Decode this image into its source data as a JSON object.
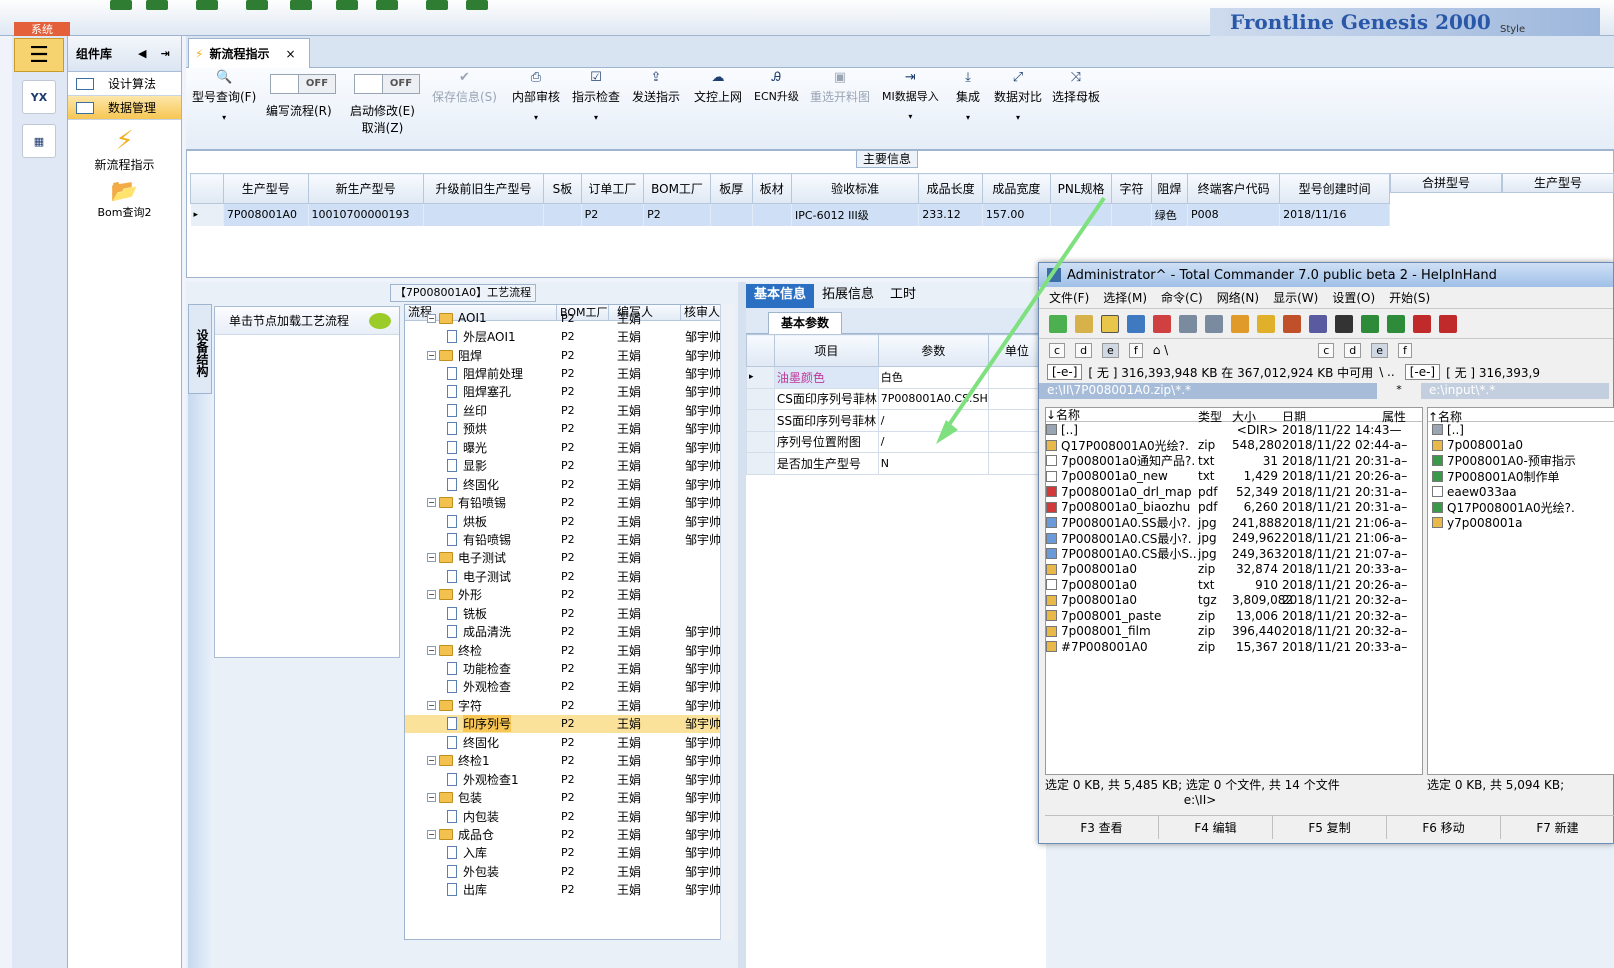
{
  "app": {
    "system_tab": "系统",
    "brand_text": "Frontline Genesis 2000",
    "style_label": "Style"
  },
  "sidebar": {
    "logo_label": "YX"
  },
  "components": {
    "header": "组件库",
    "items": [
      {
        "label": "设计算法"
      },
      {
        "label": "数据管理"
      }
    ],
    "big_items": [
      {
        "label": "新流程指示"
      },
      {
        "label": "Bom查询2"
      }
    ]
  },
  "tab": {
    "title": "新流程指示",
    "close": "×"
  },
  "ribbon": {
    "buttons": [
      {
        "label": "型号查询(F)",
        "icon": "🔍"
      },
      {
        "label": "编写流程(R)",
        "toggle": "OFF"
      },
      {
        "label": "启动修改(E)",
        "sub": "取消(Z)",
        "toggle": "OFF"
      },
      {
        "label": "保存信息(S)",
        "icon": "✔"
      },
      {
        "label": "内部审核",
        "icon": "⎙"
      },
      {
        "label": "指示检查",
        "icon": "☑"
      },
      {
        "label": "发送指示",
        "icon": "⇪"
      },
      {
        "label": "文控上网",
        "icon": "☁"
      },
      {
        "label": "ECN升级",
        "icon": "Ꭿ"
      },
      {
        "label": "重选开料图",
        "icon": "▣"
      },
      {
        "label": "MI数据导入",
        "icon": "⇥"
      },
      {
        "label": "集成",
        "icon": "⤓"
      },
      {
        "label": "数据对比",
        "icon": "⤢"
      },
      {
        "label": "选择母板",
        "icon": "⤨"
      }
    ]
  },
  "main_info": {
    "title": "主要信息",
    "columns": [
      "生产型号",
      "新生产型号",
      "升级前旧生产型号",
      "S板",
      "订单工厂",
      "BOM工厂",
      "板厚",
      "板材",
      "验收标准",
      "成品长度",
      "成品宽度",
      "PNL规格",
      "字符",
      "阻焊",
      "终端客户代码",
      "型号创建时间"
    ],
    "row": [
      "7P008001A0",
      "10010700000193",
      "",
      "",
      "P2",
      "P2",
      "",
      "",
      "IPC-6012 III级",
      "233.12",
      "157.00",
      "",
      "",
      "绿色",
      "P008",
      "2018/11/16"
    ],
    "right_columns": [
      "合拼型号",
      "生产型号"
    ]
  },
  "equipment": {
    "tab": "设备结构",
    "hint": "单击节点加载工艺流程"
  },
  "process": {
    "title": "【7P008001A0】工艺流程",
    "columns": [
      "流程",
      "BOM工厂",
      "编写人",
      "核审人"
    ],
    "rows": [
      {
        "name": "AOI1",
        "level": 0,
        "type": "folder",
        "bom": "P2",
        "writer": "王娟",
        "reviewer": ""
      },
      {
        "name": "外层AOI1",
        "level": 1,
        "type": "doc",
        "bom": "P2",
        "writer": "王娟",
        "reviewer": "邹宇帅"
      },
      {
        "name": "阻焊",
        "level": 0,
        "type": "folder",
        "bom": "P2",
        "writer": "王娟",
        "reviewer": "邹宇帅"
      },
      {
        "name": "阻焊前处理",
        "level": 1,
        "type": "doc",
        "bom": "P2",
        "writer": "王娟",
        "reviewer": "邹宇帅"
      },
      {
        "name": "阻焊塞孔",
        "level": 1,
        "type": "doc",
        "bom": "P2",
        "writer": "王娟",
        "reviewer": "邹宇帅"
      },
      {
        "name": "丝印",
        "level": 1,
        "type": "doc",
        "bom": "P2",
        "writer": "王娟",
        "reviewer": "邹宇帅"
      },
      {
        "name": "预烘",
        "level": 1,
        "type": "doc",
        "bom": "P2",
        "writer": "王娟",
        "reviewer": "邹宇帅"
      },
      {
        "name": "曝光",
        "level": 1,
        "type": "doc",
        "bom": "P2",
        "writer": "王娟",
        "reviewer": "邹宇帅"
      },
      {
        "name": "显影",
        "level": 1,
        "type": "doc",
        "bom": "P2",
        "writer": "王娟",
        "reviewer": "邹宇帅"
      },
      {
        "name": "终固化",
        "level": 1,
        "type": "doc",
        "bom": "P2",
        "writer": "王娟",
        "reviewer": "邹宇帅"
      },
      {
        "name": "有铅喷锡",
        "level": 0,
        "type": "folder",
        "bom": "P2",
        "writer": "王娟",
        "reviewer": "邹宇帅"
      },
      {
        "name": "烘板",
        "level": 1,
        "type": "doc",
        "bom": "P2",
        "writer": "王娟",
        "reviewer": "邹宇帅"
      },
      {
        "name": "有铅喷锡",
        "level": 1,
        "type": "doc",
        "bom": "P2",
        "writer": "王娟",
        "reviewer": "邹宇帅"
      },
      {
        "name": "电子测试",
        "level": 0,
        "type": "folder",
        "bom": "P2",
        "writer": "王娟",
        "reviewer": ""
      },
      {
        "name": "电子测试",
        "level": 1,
        "type": "doc",
        "bom": "P2",
        "writer": "王娟",
        "reviewer": ""
      },
      {
        "name": "外形",
        "level": 0,
        "type": "folder",
        "bom": "P2",
        "writer": "王娟",
        "reviewer": ""
      },
      {
        "name": "铣板",
        "level": 1,
        "type": "doc",
        "bom": "P2",
        "writer": "王娟",
        "reviewer": ""
      },
      {
        "name": "成品清洗",
        "level": 1,
        "type": "doc",
        "bom": "P2",
        "writer": "王娟",
        "reviewer": "邹宇帅"
      },
      {
        "name": "终检",
        "level": 0,
        "type": "folder",
        "bom": "P2",
        "writer": "王娟",
        "reviewer": "邹宇帅"
      },
      {
        "name": "功能检查",
        "level": 1,
        "type": "doc",
        "bom": "P2",
        "writer": "王娟",
        "reviewer": "邹宇帅"
      },
      {
        "name": "外观检查",
        "level": 1,
        "type": "doc",
        "bom": "P2",
        "writer": "王娟",
        "reviewer": "邹宇帅"
      },
      {
        "name": "字符",
        "level": 0,
        "type": "folder",
        "bom": "P2",
        "writer": "王娟",
        "reviewer": "邹宇帅"
      },
      {
        "name": "印序列号",
        "level": 1,
        "type": "doc",
        "bom": "P2",
        "writer": "王娟",
        "reviewer": "邹宇帅",
        "selected": true
      },
      {
        "name": "终固化",
        "level": 1,
        "type": "doc",
        "bom": "P2",
        "writer": "王娟",
        "reviewer": "邹宇帅"
      },
      {
        "name": "终检1",
        "level": 0,
        "type": "folder",
        "bom": "P2",
        "writer": "王娟",
        "reviewer": "邹宇帅"
      },
      {
        "name": "外观检查1",
        "level": 1,
        "type": "doc",
        "bom": "P2",
        "writer": "王娟",
        "reviewer": "邹宇帅"
      },
      {
        "name": "包装",
        "level": 0,
        "type": "folder",
        "bom": "P2",
        "writer": "王娟",
        "reviewer": "邹宇帅"
      },
      {
        "name": "内包装",
        "level": 1,
        "type": "doc",
        "bom": "P2",
        "writer": "王娟",
        "reviewer": "邹宇帅"
      },
      {
        "name": "成品仓",
        "level": 0,
        "type": "folder",
        "bom": "P2",
        "writer": "王娟",
        "reviewer": "邹宇帅"
      },
      {
        "name": "入库",
        "level": 1,
        "type": "doc",
        "bom": "P2",
        "writer": "王娟",
        "reviewer": "邹宇帅"
      },
      {
        "name": "外包装",
        "level": 1,
        "type": "doc",
        "bom": "P2",
        "writer": "王娟",
        "reviewer": "邹宇帅"
      },
      {
        "name": "出库",
        "level": 1,
        "type": "doc",
        "bom": "P2",
        "writer": "王娟",
        "reviewer": "邹宇帅"
      }
    ]
  },
  "info": {
    "tabs": [
      "基本信息",
      "拓展信息",
      "工时"
    ],
    "sub_tab": "基本参数",
    "columns": [
      "项目",
      "参数",
      "单位"
    ],
    "rows": [
      {
        "item": "油墨颜色",
        "param": "白色",
        "highlight": true
      },
      {
        "item": "CS面印序列号菲林",
        "param": "7P008001A0.CS.SH"
      },
      {
        "item": "SS面印序列号菲林",
        "param": "/"
      },
      {
        "item": "序列号位置附图",
        "param": "/"
      },
      {
        "item": "是否加生产型号",
        "param": "N"
      }
    ]
  },
  "tc": {
    "title": "Administrator^ - Total Commander 7.0 public beta 2 - HelpInHand",
    "menu": [
      "文件(F)",
      "选择(M)",
      "命令(C)",
      "网络(N)",
      "显示(W)",
      "设置(O)",
      "开始(S)"
    ],
    "drives_left": [
      "c",
      "d",
      "e",
      "f"
    ],
    "drives_right": [
      "c",
      "d",
      "e",
      "f"
    ],
    "left_drive": "[-e-]",
    "left_free": "[ 无 ]  316,393,948 KB 在 367,012,924 KB 中可用",
    "left_sep": "\\  ..",
    "left_path": "e:\\II\\7P008001A0.zip\\*.*",
    "left_filter": "*",
    "right_drive": "[-e-]",
    "right_free": "[ 无 ]  316,393,9",
    "right_path": "e:\\input\\*.*",
    "headers": [
      "↓名称",
      "类型",
      "大小",
      "日期",
      "属性"
    ],
    "right_header": "↑名称",
    "files": [
      {
        "name": "[..]",
        "type": "",
        "size": "<DIR>",
        "date": "2018/11/22 14:43—",
        "icon": "up"
      },
      {
        "name": "Q17P008001A0光绘?.",
        "type": "zip",
        "size": "548,280",
        "date": "2018/11/22 02:44-a–",
        "icon": "zip"
      },
      {
        "name": "7p008001a0通知产品?.",
        "type": "txt",
        "size": "31",
        "date": "2018/11/21 20:31-a–",
        "icon": "txt"
      },
      {
        "name": "7p008001a0_new",
        "type": "txt",
        "size": "1,429",
        "date": "2018/11/21 20:26-a–",
        "icon": "txt"
      },
      {
        "name": "7p008001a0_drl_map",
        "type": "pdf",
        "size": "52,349",
        "date": "2018/11/21 20:31-a–",
        "icon": "pdf"
      },
      {
        "name": "7p008001a0_biaozhu",
        "type": "pdf",
        "size": "6,260",
        "date": "2018/11/21 20:31-a–",
        "icon": "pdf"
      },
      {
        "name": "7P008001A0.SS最小?.",
        "type": "jpg",
        "size": "241,888",
        "date": "2018/11/21 21:06-a–",
        "icon": "jpg"
      },
      {
        "name": "7P008001A0.CS最小?.",
        "type": "jpg",
        "size": "249,962",
        "date": "2018/11/21 21:06-a–",
        "icon": "jpg"
      },
      {
        "name": "7P008001A0.CS最小S..",
        "type": "jpg",
        "size": "249,363",
        "date": "2018/11/21 21:07-a–",
        "icon": "jpg"
      },
      {
        "name": "7p008001a0",
        "type": "zip",
        "size": "32,874",
        "date": "2018/11/21 20:33-a–",
        "icon": "zip"
      },
      {
        "name": "7p008001a0",
        "type": "txt",
        "size": "910",
        "date": "2018/11/21 20:26-a–",
        "icon": "txt"
      },
      {
        "name": "7p008001a0",
        "type": "tgz",
        "size": "3,809,082",
        "date": "2018/11/21 20:32-a–",
        "icon": "zip"
      },
      {
        "name": "7p008001_paste",
        "type": "zip",
        "size": "13,006",
        "date": "2018/11/21 20:32-a–",
        "icon": "zip"
      },
      {
        "name": "7p008001_film",
        "type": "zip",
        "size": "396,440",
        "date": "2018/11/21 20:32-a–",
        "icon": "zip"
      },
      {
        "name": "#7P008001A0",
        "type": "zip",
        "size": "15,367",
        "date": "2018/11/21 20:33-a–",
        "icon": "zip"
      }
    ],
    "right_files": [
      {
        "name": "[..]",
        "icon": "up"
      },
      {
        "name": "7p008001a0",
        "icon": "zip"
      },
      {
        "name": "7P008001A0-预审指示",
        "icon": "xls"
      },
      {
        "name": "7P008001A0制作单",
        "icon": "xls"
      },
      {
        "name": "eaew033aa",
        "icon": "txt"
      },
      {
        "name": "Q17P008001A0光绘?.",
        "icon": "xls"
      },
      {
        "name": "y7p008001a",
        "icon": "zip"
      }
    ],
    "status_left": "选定 0 KB, 共 5,485 KB; 选定 0 个文件, 共 14 个文件",
    "status_right": "选定 0 KB, 共 5,094 KB;",
    "cmd_path": "e:\\II>",
    "fkeys": [
      "F3 查看",
      "F4 编辑",
      "F5 复制",
      "F6 移动",
      "F7 新建"
    ]
  },
  "colors": {
    "accent": "#2a6fc1",
    "selected": "#f7c654",
    "arrow": "#7ee07e"
  }
}
